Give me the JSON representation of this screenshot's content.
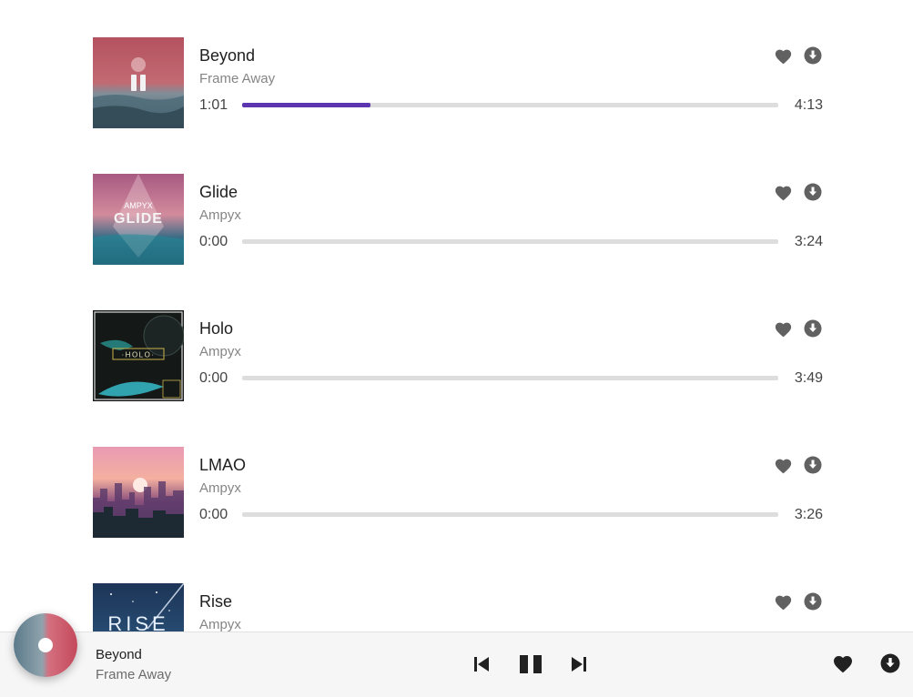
{
  "tracks": [
    {
      "title": "Beyond",
      "artist": "Frame Away",
      "current": "1:01",
      "duration": "4:13",
      "progress": 0.24,
      "playing": true,
      "cover_icon": "album-cover-beyond"
    },
    {
      "title": "Glide",
      "artist": "Ampyx",
      "current": "0:00",
      "duration": "3:24",
      "progress": 0,
      "playing": false,
      "cover_icon": "album-cover-glide"
    },
    {
      "title": "Holo",
      "artist": "Ampyx",
      "current": "0:00",
      "duration": "3:49",
      "progress": 0,
      "playing": false,
      "cover_icon": "album-cover-holo"
    },
    {
      "title": "LMAO",
      "artist": "Ampyx",
      "current": "0:00",
      "duration": "3:26",
      "progress": 0,
      "playing": false,
      "cover_icon": "album-cover-lmao"
    },
    {
      "title": "Rise",
      "artist": "Ampyx",
      "current": "",
      "duration": "",
      "progress": 0,
      "playing": false,
      "cover_icon": "album-cover-rise"
    }
  ],
  "cover_text": {
    "glide_artist": "AMPYX",
    "glide_title": "GLIDE",
    "holo_title": "·HOLO·",
    "rise_title": "RISE"
  },
  "player": {
    "title": "Beyond",
    "artist": "Frame Away"
  },
  "icons": {
    "favorite": "heart-icon",
    "download": "download-icon",
    "prev": "skip-previous-icon",
    "pause": "pause-icon",
    "next": "skip-next-icon"
  },
  "colors": {
    "accent": "#5e35b1",
    "icon": "#616161",
    "track_bg": "#dddddd",
    "player_bg": "#f6f6f7"
  }
}
